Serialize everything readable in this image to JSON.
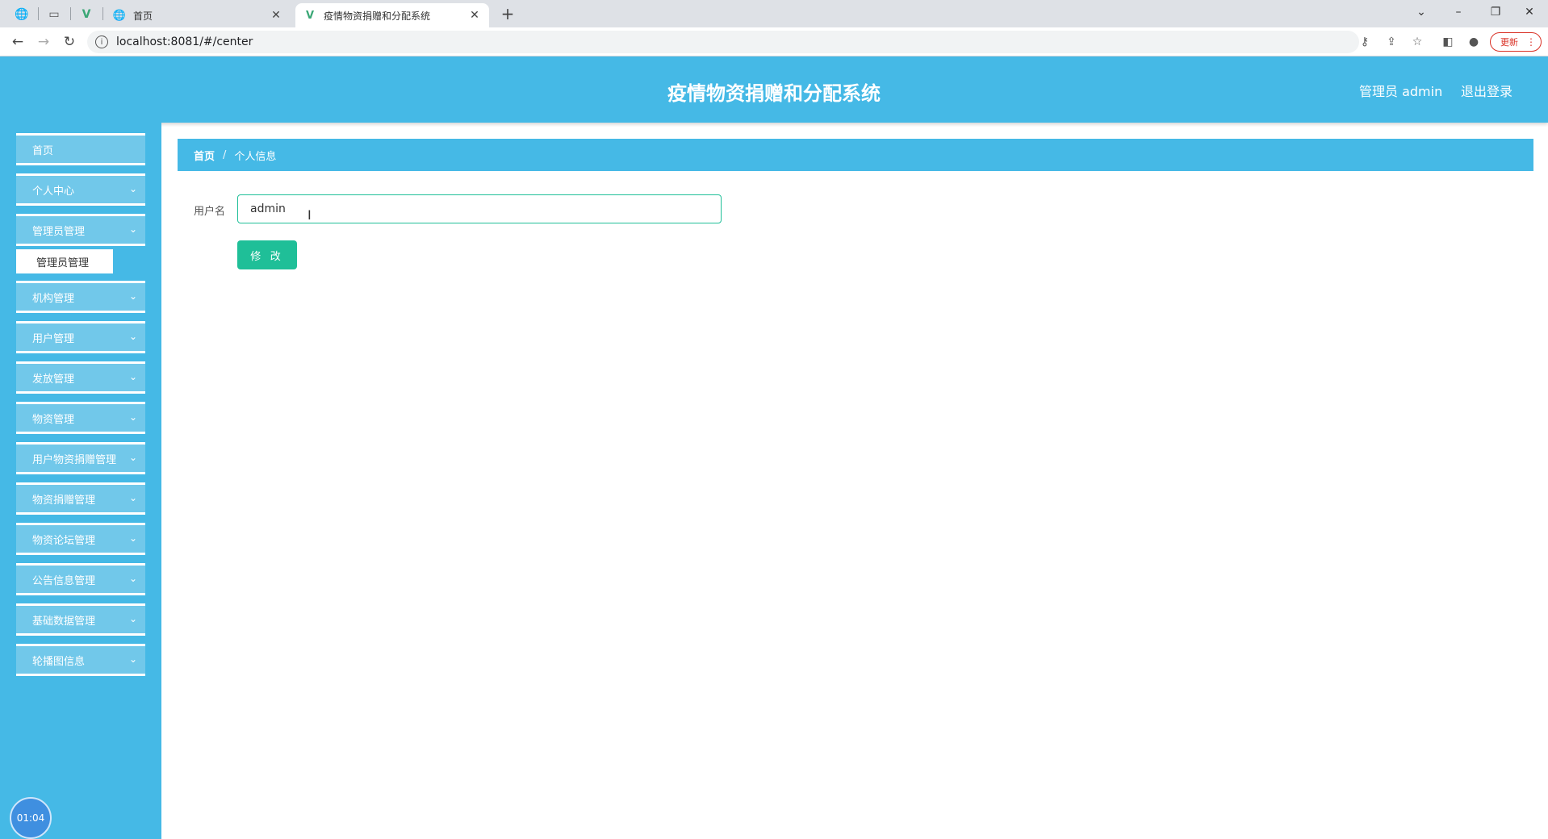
{
  "browser": {
    "tabs": [
      {
        "title": "首页"
      },
      {
        "title": "疫情物资捐赠和分配系统"
      }
    ],
    "url": "localhost:8081/#/center",
    "update_label": "更新"
  },
  "header": {
    "title": "疫情物资捐赠和分配系统",
    "user_label": "管理员 admin",
    "logout_label": "退出登录"
  },
  "sidebar": {
    "items": [
      {
        "label": "首页",
        "has_submenu": false
      },
      {
        "label": "个人中心",
        "has_submenu": true
      },
      {
        "label": "管理员管理",
        "has_submenu": true
      },
      {
        "label": "机构管理",
        "has_submenu": true
      },
      {
        "label": "用户管理",
        "has_submenu": true
      },
      {
        "label": "发放管理",
        "has_submenu": true
      },
      {
        "label": "物资管理",
        "has_submenu": true
      },
      {
        "label": "用户物资捐赠管理",
        "has_submenu": true
      },
      {
        "label": "物资捐赠管理",
        "has_submenu": true
      },
      {
        "label": "物资论坛管理",
        "has_submenu": true
      },
      {
        "label": "公告信息管理",
        "has_submenu": true
      },
      {
        "label": "基础数据管理",
        "has_submenu": true
      },
      {
        "label": "轮播图信息",
        "has_submenu": true
      }
    ],
    "open_submenu": {
      "label": "管理员管理"
    },
    "timer": "01:04"
  },
  "breadcrumb": {
    "home": "首页",
    "separator": "/",
    "current": "个人信息"
  },
  "form": {
    "username_label": "用户名",
    "username_value": "admin",
    "submit_label": "修 改"
  },
  "colors": {
    "primary": "#45b9e6",
    "menu_item": "#71c8ea",
    "button": "#1fbf98"
  }
}
